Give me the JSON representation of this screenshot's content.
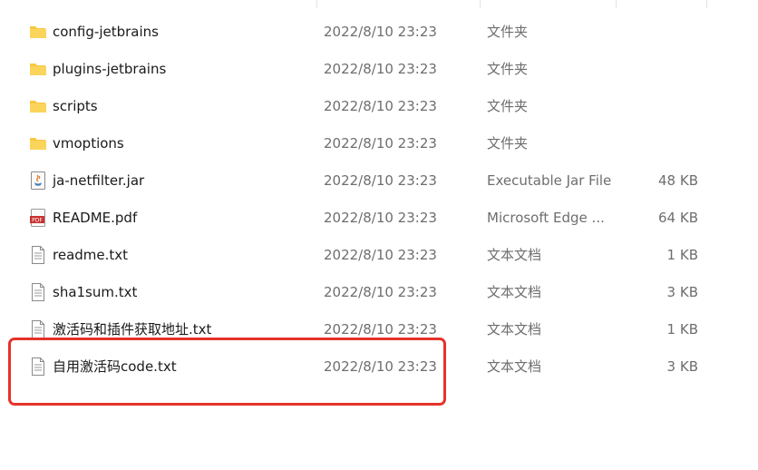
{
  "files": [
    {
      "name": "config-jetbrains",
      "date": "2022/8/10 23:23",
      "type": "文件夹",
      "size": "",
      "icon": "folder-icon"
    },
    {
      "name": "plugins-jetbrains",
      "date": "2022/8/10 23:23",
      "type": "文件夹",
      "size": "",
      "icon": "folder-icon"
    },
    {
      "name": "scripts",
      "date": "2022/8/10 23:23",
      "type": "文件夹",
      "size": "",
      "icon": "folder-icon"
    },
    {
      "name": "vmoptions",
      "date": "2022/8/10 23:23",
      "type": "文件夹",
      "size": "",
      "icon": "folder-icon"
    },
    {
      "name": "ja-netfilter.jar",
      "date": "2022/8/10 23:23",
      "type": "Executable Jar File",
      "size": "48 KB",
      "icon": "java-jar-icon"
    },
    {
      "name": "README.pdf",
      "date": "2022/8/10 23:23",
      "type": "Microsoft Edge ...",
      "size": "64 KB",
      "icon": "pdf-icon"
    },
    {
      "name": "readme.txt",
      "date": "2022/8/10 23:23",
      "type": "文本文档",
      "size": "1 KB",
      "icon": "text-file-icon"
    },
    {
      "name": "sha1sum.txt",
      "date": "2022/8/10 23:23",
      "type": "文本文档",
      "size": "3 KB",
      "icon": "text-file-icon"
    },
    {
      "name": "激活码和插件获取地址.txt",
      "date": "2022/8/10 23:23",
      "type": "文本文档",
      "size": "1 KB",
      "icon": "text-file-icon"
    },
    {
      "name": "自用激活码code.txt",
      "date": "2022/8/10 23:23",
      "type": "文本文档",
      "size": "3 KB",
      "icon": "text-file-icon"
    }
  ],
  "colors": {
    "folder": "#f8c840",
    "highlight": "#e5332a",
    "pdf": "#c8302f",
    "secondary_text": "#6e6e6e"
  }
}
